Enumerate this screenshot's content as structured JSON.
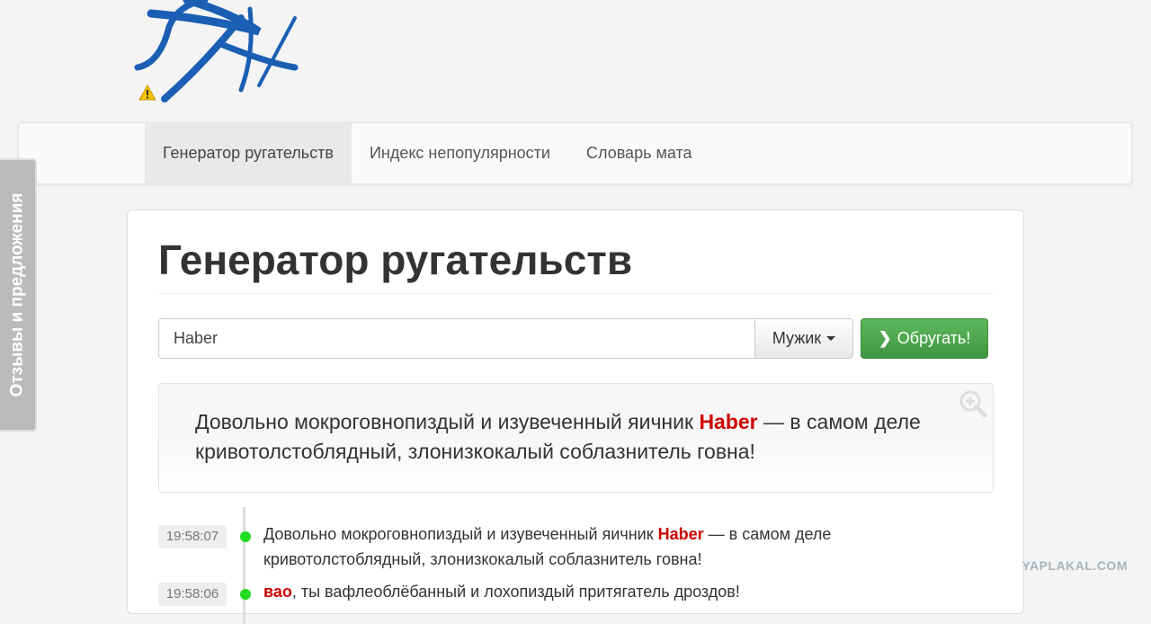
{
  "logo": {
    "name": "logo"
  },
  "nav": {
    "items": [
      {
        "label": "Генератор ругательств",
        "active": true
      },
      {
        "label": "Индекс непопулярности"
      },
      {
        "label": "Словарь мата"
      }
    ]
  },
  "sidebar_tab": "Отзывы и предложения",
  "main": {
    "title": "Генератор ругательств",
    "name_input": "Haber",
    "gender_select": "Мужик",
    "submit_label": "Обругать!",
    "result": {
      "before": "Довольно мокроговнопиздый и изувеченный яичник ",
      "name": "Haber",
      "after": " — в самом деле кривотолстоблядный, злонизкокалый соблазнитель говна!"
    },
    "history": [
      {
        "time": "19:58:07",
        "before": "Довольно мокроговнопиздый и изувеченный яичник ",
        "name": "Haber",
        "after": " — в самом деле кривотолстоблядный, злонизкокалый соблазнитель говна!"
      },
      {
        "time": "19:58:06",
        "before": "",
        "name": "вао",
        "after": ", ты вафлеоблёбанный и лохопиздый притягатель дроздов!"
      }
    ]
  },
  "watermark": "YAPLAKAL.COM",
  "colors": {
    "accent_red": "#cc0000",
    "button_green": "#4cae4c",
    "logo_blue": "#1a5fb4"
  }
}
